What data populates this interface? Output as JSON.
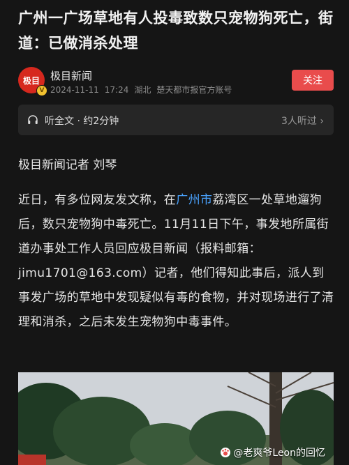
{
  "article": {
    "title": "广州一广场草地有人投毒致数只宠物狗死亡，街道：已做消杀处理"
  },
  "author": {
    "avatar_text": "极目",
    "verified_icon": "v-badge-icon",
    "name": "极目新闻",
    "date": "2024-11-11",
    "time": "17:24",
    "location": "湖北",
    "account": "楚天都市报官方账号",
    "follow_label": "关注",
    "accent": "#e94c4c"
  },
  "audio": {
    "icon": "headphones-icon",
    "label": "听全文 · 约2分钟",
    "listeners": "3人听过",
    "chevron": "›"
  },
  "body": {
    "reporter": "极目新闻记者 刘琴",
    "p1_before": "近日，有多位网友发文称，在",
    "p1_link": "广州市",
    "p1_after": "荔湾区一处草地遛狗后，数只宠物狗中毒死亡。11月11日下午，事发地所属街道办事处工作人员回应极目新闻（报料邮箱：jimu1701@163.com）记者，他们得知此事后，派人到事发广场的草地中发现疑似有毒的食物，并对现场进行了清理和消杀，之后未发生宠物狗中毒事件。",
    "link_color": "#4aa3ff"
  },
  "photo": {
    "watermark": "@老爽爷Leon的回忆"
  }
}
